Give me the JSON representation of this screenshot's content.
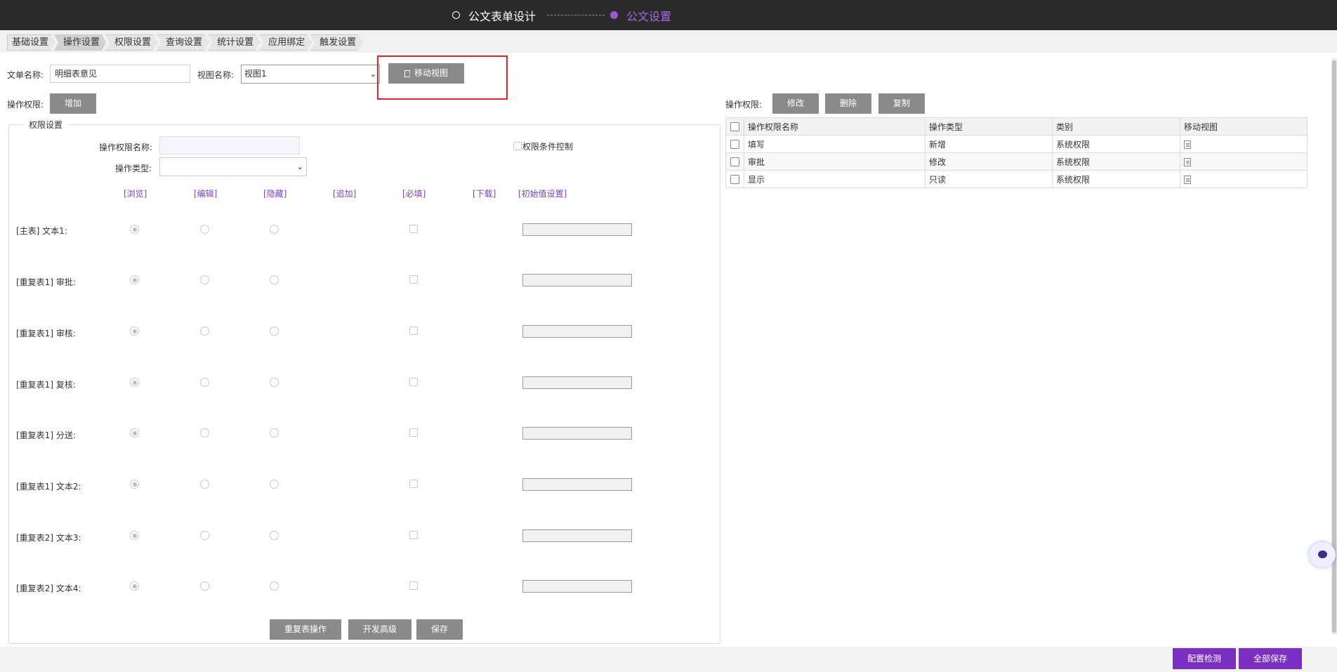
{
  "steps": [
    {
      "label": "公文表单设计",
      "state": "done"
    },
    {
      "label": "公文设置",
      "state": "active"
    }
  ],
  "tabs": [
    "基础设置",
    "操作设置",
    "权限设置",
    "查询设置",
    "统计设置",
    "应用绑定",
    "触发设置"
  ],
  "active_tab": "操作设置",
  "form": {
    "doc_name_label": "文单名称:",
    "doc_name_value": "明细表意见",
    "view_name_label": "视图名称:",
    "view_name_value": "视图1",
    "move_view_button": "移动视图",
    "op_perm_label": "操作权限:",
    "add_button": "增加"
  },
  "perm_settings": {
    "legend": "权限设置",
    "name_label": "操作权限名称:",
    "type_label": "操作类型:",
    "condition_label": "权限条件控制",
    "columns": [
      "[浏览]",
      "[编辑]",
      "[隐藏]",
      "[追加]",
      "[必填]",
      "[下载]",
      "[初始值设置]"
    ],
    "rows": [
      "[主表] 文本1:",
      "[重复表1] 审批:",
      "[重复表1] 审核:",
      "[重复表1] 复核:",
      "[重复表1] 分送:",
      "[重复表1] 文本2:",
      "[重复表2] 文本3:",
      "[重复表2] 文本4:"
    ],
    "buttons": [
      "重复表操作",
      "开发高级",
      "保存"
    ]
  },
  "right_panel": {
    "label": "操作权限:",
    "buttons": [
      "修改",
      "删除",
      "复制"
    ],
    "table_headers": [
      "操作权限名称",
      "操作类型",
      "类别",
      "移动视图"
    ],
    "table_rows": [
      [
        "填写",
        "新增",
        "系统权限"
      ],
      [
        "审批",
        "修改",
        "系统权限"
      ],
      [
        "显示",
        "只读",
        "系统权限"
      ]
    ]
  },
  "footer": {
    "config_check": "配置检测",
    "save_all": "全部保存"
  },
  "colors": {
    "accent": "#7b2fc2",
    "highlight": "#e8242a",
    "topbar": "#2b2b2b"
  }
}
